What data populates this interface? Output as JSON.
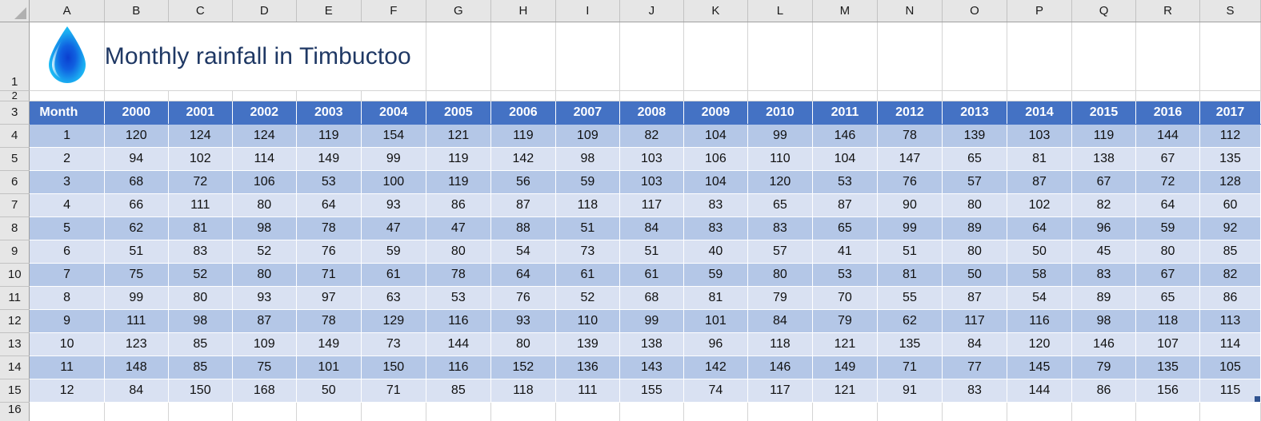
{
  "app": {
    "type": "spreadsheet",
    "select_all_icon": "select-all-triangle-icon"
  },
  "columns": [
    "A",
    "B",
    "C",
    "D",
    "E",
    "F",
    "G",
    "H",
    "I",
    "J",
    "K",
    "L",
    "M",
    "N",
    "O",
    "P",
    "Q",
    "R",
    "S"
  ],
  "rows": [
    "1",
    "2",
    "3",
    "4",
    "5",
    "6",
    "7",
    "8",
    "9",
    "10",
    "11",
    "12",
    "13",
    "14",
    "15",
    "16"
  ],
  "title": {
    "text": "Monthly rainfall in Timbuctoo",
    "color": "#1F3864",
    "logo_icon": "water-droplet-icon"
  },
  "theme": {
    "header_fill": "#4472C4",
    "band_dark": "#B4C7E7",
    "band_light": "#D9E1F2",
    "header_text": "#FFFFFF",
    "grid_line": "#D4D4D4",
    "handle_color": "#2F528F"
  },
  "table_data": {
    "type": "table",
    "headers": [
      "Month",
      "2000",
      "2001",
      "2002",
      "2003",
      "2004",
      "2005",
      "2006",
      "2007",
      "2008",
      "2009",
      "2010",
      "2011",
      "2012",
      "2013",
      "2014",
      "2015",
      "2016",
      "2017"
    ],
    "rows": [
      [
        "1",
        "120",
        "124",
        "124",
        "119",
        "154",
        "121",
        "119",
        "109",
        "82",
        "104",
        "99",
        "146",
        "78",
        "139",
        "103",
        "119",
        "144",
        "112"
      ],
      [
        "2",
        "94",
        "102",
        "114",
        "149",
        "99",
        "119",
        "142",
        "98",
        "103",
        "106",
        "110",
        "104",
        "147",
        "65",
        "81",
        "138",
        "67",
        "135"
      ],
      [
        "3",
        "68",
        "72",
        "106",
        "53",
        "100",
        "119",
        "56",
        "59",
        "103",
        "104",
        "120",
        "53",
        "76",
        "57",
        "87",
        "67",
        "72",
        "128"
      ],
      [
        "4",
        "66",
        "111",
        "80",
        "64",
        "93",
        "86",
        "87",
        "118",
        "117",
        "83",
        "65",
        "87",
        "90",
        "80",
        "102",
        "82",
        "64",
        "60"
      ],
      [
        "5",
        "62",
        "81",
        "98",
        "78",
        "47",
        "47",
        "88",
        "51",
        "84",
        "83",
        "83",
        "65",
        "99",
        "89",
        "64",
        "96",
        "59",
        "92"
      ],
      [
        "6",
        "51",
        "83",
        "52",
        "76",
        "59",
        "80",
        "54",
        "73",
        "51",
        "40",
        "57",
        "41",
        "51",
        "80",
        "50",
        "45",
        "80",
        "85"
      ],
      [
        "7",
        "75",
        "52",
        "80",
        "71",
        "61",
        "78",
        "64",
        "61",
        "61",
        "59",
        "80",
        "53",
        "81",
        "50",
        "58",
        "83",
        "67",
        "82"
      ],
      [
        "8",
        "99",
        "80",
        "93",
        "97",
        "63",
        "53",
        "76",
        "52",
        "68",
        "81",
        "79",
        "70",
        "55",
        "87",
        "54",
        "89",
        "65",
        "86"
      ],
      [
        "9",
        "111",
        "98",
        "87",
        "78",
        "129",
        "116",
        "93",
        "110",
        "99",
        "101",
        "84",
        "79",
        "62",
        "117",
        "116",
        "98",
        "118",
        "113"
      ],
      [
        "10",
        "123",
        "85",
        "109",
        "149",
        "73",
        "144",
        "80",
        "139",
        "138",
        "96",
        "118",
        "121",
        "135",
        "84",
        "120",
        "146",
        "107",
        "114"
      ],
      [
        "11",
        "148",
        "85",
        "75",
        "101",
        "150",
        "116",
        "152",
        "136",
        "143",
        "142",
        "146",
        "149",
        "71",
        "77",
        "145",
        "79",
        "135",
        "105"
      ],
      [
        "12",
        "84",
        "150",
        "168",
        "50",
        "71",
        "85",
        "118",
        "111",
        "155",
        "74",
        "117",
        "121",
        "91",
        "83",
        "144",
        "86",
        "156",
        "115"
      ]
    ]
  }
}
